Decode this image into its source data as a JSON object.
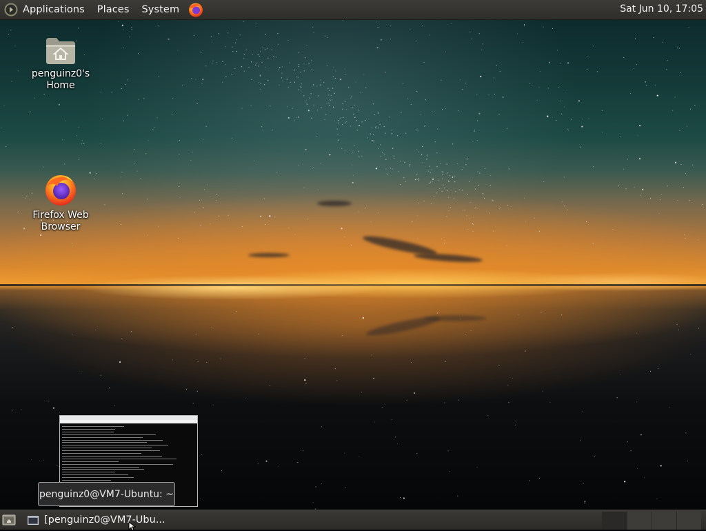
{
  "top_panel": {
    "menus": [
      "Applications",
      "Places",
      "System"
    ],
    "clock": "Sat Jun 10, 17:05"
  },
  "desktop": {
    "icons": [
      {
        "label": "penguinz0's Home",
        "icon": "home-folder-icon"
      },
      {
        "label": "Firefox Web Browser",
        "icon": "firefox-icon"
      }
    ]
  },
  "tooltip": {
    "text": "penguinz0@VM7-Ubuntu: ~"
  },
  "bottom_panel": {
    "task": "[penguinz0@VM7-Ubu...",
    "workspaces": 4
  },
  "colors": {
    "panel": "#3c3b37",
    "accent": "#f0a032"
  }
}
